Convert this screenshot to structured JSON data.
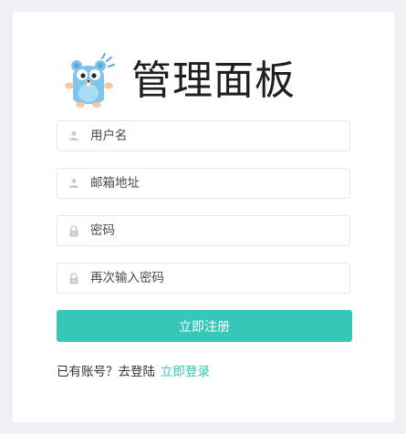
{
  "app": {
    "title": "管理面板"
  },
  "form": {
    "username": {
      "placeholder": "用户名",
      "icon": "user-icon"
    },
    "email": {
      "placeholder": "邮箱地址",
      "icon": "user-icon"
    },
    "password": {
      "placeholder": "密码",
      "icon": "lock-icon"
    },
    "confirm_password": {
      "placeholder": "再次输入密码",
      "icon": "lock-icon"
    },
    "submit_label": "立即注册"
  },
  "footer": {
    "prompt": "已有账号？去登陆",
    "login_link": "立即登录"
  },
  "colors": {
    "accent": "#35c8b9",
    "background": "#eef0f6",
    "card": "#ffffff",
    "input_border": "#e6e8eb",
    "icon_gray": "#c9cbd1"
  }
}
